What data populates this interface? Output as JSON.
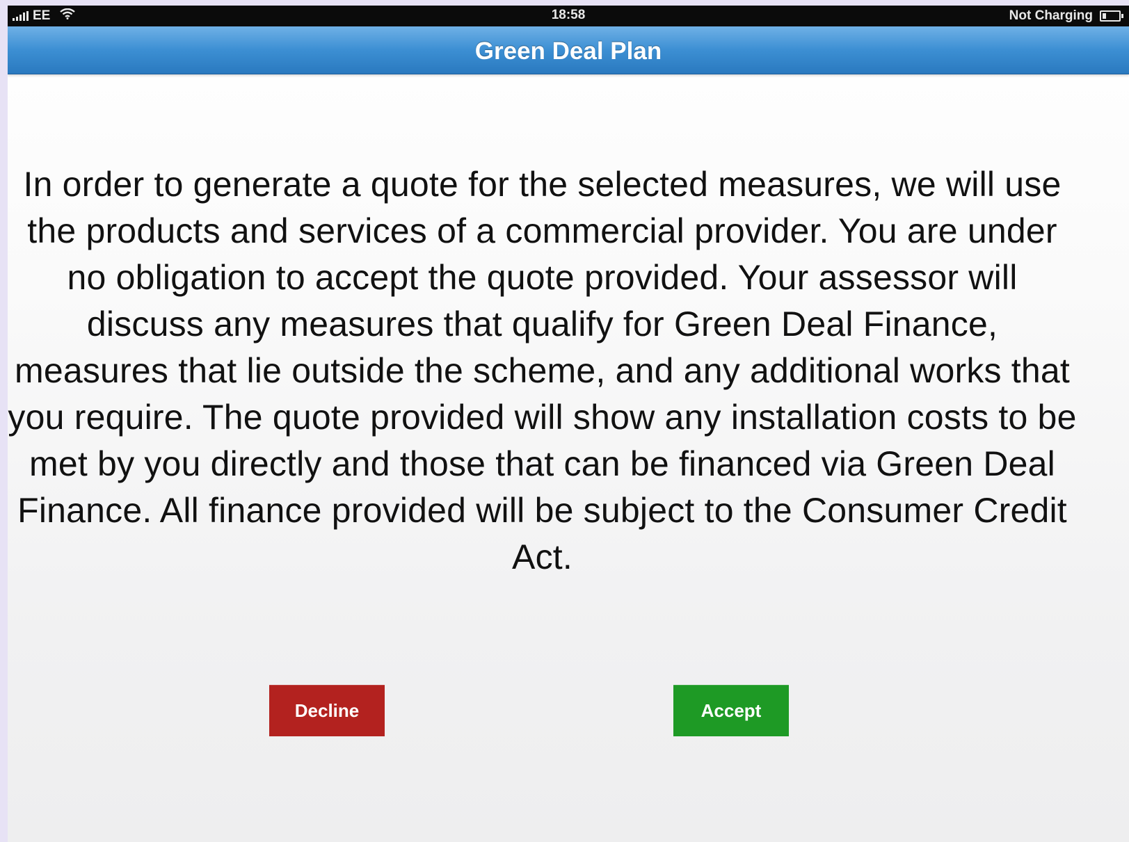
{
  "status_bar": {
    "carrier": "EE",
    "time": "18:58",
    "battery_status": "Not Charging",
    "icons": [
      "signal-icon",
      "wifi-icon",
      "battery-icon"
    ]
  },
  "header": {
    "title": "Green Deal Plan"
  },
  "main": {
    "disclaimer": "In order to generate a quote for the selected measures, we will use the products and services of a commercial provider. You are under no obligation to accept the quote provided. Your assessor will discuss any measures that qualify for Green Deal Finance, measures that lie outside the scheme, and any additional works that you require. The quote provided will show any installation costs to be met by you directly and those that can be financed via Green Deal Finance. All finance provided will be subject to the Consumer Credit Act."
  },
  "actions": {
    "decline_label": "Decline",
    "accept_label": "Accept"
  },
  "colors": {
    "nav_bar": "#3c8fd3",
    "decline": "#b3221f",
    "accept": "#1e9a25",
    "status_bar": "#0b0b0b"
  }
}
